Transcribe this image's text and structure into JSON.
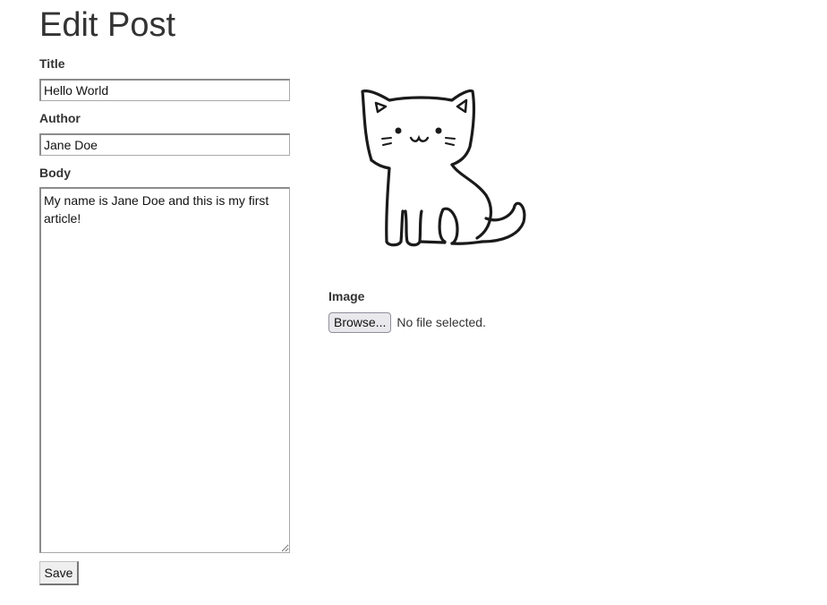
{
  "page": {
    "title": "Edit Post"
  },
  "form": {
    "title_label": "Title",
    "title_value": "Hello World",
    "author_label": "Author",
    "author_value": "Jane Doe",
    "body_label": "Body",
    "body_value": "My name is Jane Doe and this is my first article!",
    "save_label": "Save"
  },
  "image_panel": {
    "image_label": "Image",
    "browse_label": "Browse...",
    "file_status": "No file selected.",
    "image_icon": "cat-illustration"
  }
}
